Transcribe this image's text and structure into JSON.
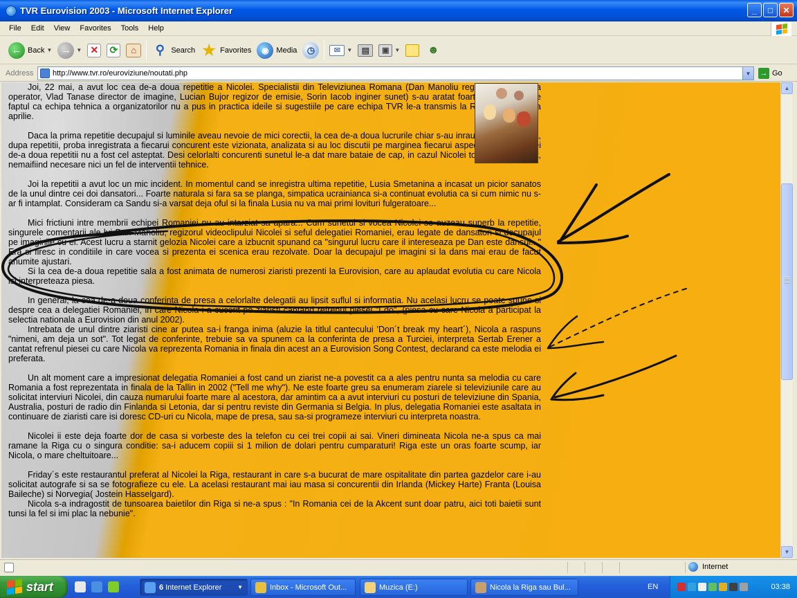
{
  "window": {
    "title": "TVR Eurovision 2003 - Microsoft Internet Explorer"
  },
  "menu": [
    "File",
    "Edit",
    "View",
    "Favorites",
    "Tools",
    "Help"
  ],
  "toolbar": {
    "back": "Back",
    "search": "Search",
    "favorites": "Favorites",
    "media": "Media"
  },
  "address": {
    "label": "Address",
    "url": "http://www.tvr.ro/euroviziune/noutati.php",
    "go": "Go"
  },
  "article": {
    "paragraphs": [
      "Joi, 22 mai, a avut loc cea de-a doua repetitie a Nicolei. Specialistii din Televiziunea Romana (Dan Manoliu regizor, Cristian Ilea operator, Vlad Tanase director de imagine, Lucian Bujor regizor de emisie, Sorin Iacob inginer sunet) s-au aratat foarte nemultumiti de faptul ca echipa tehnica a organizatorilor nu a pus in practica ideile si sugestiile pe care echipa TVR le-a transmis la Riga inca din luna aprilie.",
      "Daca la prima repetitie decupajul si luminile aveau nevoie de mici corectii, la cea de-a doua lucrurile chiar s-au inrautatit. Cu toate ca, dupa repetitii, proba inregistrata a fiecarui concurent este vizionata, analizata si au loc discutii pe marginea fiecarui aspect, rezultatul celei de-a doua repetitii nu a fost cel asteptat. Desi celorlalti concurenti sunetul le-a dat mare bataie de cap, in cazul Nicolei totul a fost perfect, nemaifiind necesare nici un fel de interventii tehnice.",
      "Joi la repetitii a avut loc un mic incident. In momentul cand se inregistra ultima repetitie, Lusia Smetanina a incasat un picior sanatos de la unul dintre cei doi dansatori... Foarte naturala si fara sa se planga, simpatica ucrainianca si-a continuat evolutia ca si cum nimic nu s-ar fi intamplat. Consideram ca Sandu si-a varsat deja oful si la finala Lusia nu va mai primi lovituri fulgeratoare...",
      "Mici frictiuni intre membrii echipei Romaniei nu au intarziat sa apara... Cum sunetul si vocea Nicolei se auzeau superb la repetitie, singurele comentarii ale lui Dan Manoliu, regizorul videoclipului Nicolei si seful delegatiei Romaniei, erau legate de dansatori si decupajul pe imaginile cu ei. Acest lucru a starnit gelozia Nicolei care a izbucnit spunand ca \"singurul lucru care il intereseaza pe Dan este dansul...\" Era si firesc in conditiile in care vocea si prezenta ei scenica erau rezolvate. Doar la decupajul pe imagini si la dans mai erau de facut anumite ajustari.",
      "Si la cea de-a doua repetitie sala a fost animata de numerosi ziaristi prezenti la Eurovision, care au aplaudat evolutia cu care Nicola isi interpreteaza piesa.",
      "In general, la cea de-a doua conferinta de presa a celorlalte delegatii au lipsit suflul si informatia. Nu acelasi lucru se poate spune si despre cea a delegatiei Romaniei, in care Nicola i-a cucerit pe ziaristi cantand refrenul piesei \"I do\", (piesa cu care Nicola a participat la selectia nationala a Eurovision din anul 2002).",
      "Intrebata de unul dintre ziaristi cine ar putea sa-i franga inima (aluzie la titlul cantecului 'Don´t break my heart´), Nicola a raspuns \"nimeni, am deja un sot\". Tot legat de conferinte, trebuie sa va spunem ca la conferinta de presa a Turciei, interpreta Sertab Erener a cantat refrenul piesei cu care Nicola va reprezenta Romania in finala din acest an a Eurovision Song Contest, declarand ca este melodia ei preferata.",
      "Un alt moment care a impresionat delegatia Romaniei a fost cand un ziarist ne-a povestit ca a ales pentru nunta sa melodia cu care Romania a fost reprezentata in finala de la Tallin in 2002 (\"Tell me why\"). Ne este foarte greu sa enumeram ziarele si televiziunile care au solicitat interviuri Nicolei, din cauza numarului foarte mare al acestora, dar amintim ca a avut interviuri cu posturi de televiziune din Spania, Australia, posturi de radio din Finlanda si Letonia, dar si pentru reviste din Germania si Belgia. In plus, delegatia Romaniei este asaltata in continuare de ziaristi care isi doresc CD-uri cu Nicola, mape de presa, sau sa-si programeze interviuri cu interpreta noastra.",
      "Nicolei ii este deja foarte dor de casa si vorbeste des la telefon cu cei trei copii ai sai. Vineri dimineata Nicola ne-a spus ca mai ramane la Riga cu o singura conditie: sa-i aducem copiii si 1 milion de dolari pentru cumparaturi! Riga este un oras foarte scump, iar Nicola, o mare cheltuitoare...",
      "Friday´s este restaurantul preferat al Nicolei la Riga, restaurant in care s-a bucurat de mare ospitalitate din partea gazdelor care i-au solicitat autografe si sa se fotografieze cu ele. La acelasi restaurant mai iau masa si concurentii din Irlanda (Mickey Harte) Franta (Louisa Baileche) si Norvegia( Jostein Hasselgard).",
      "Nicola s-a indragostit de tunsoarea baietilor din Riga si ne-a spus : \"In Romania cei de la Akcent sunt doar patru, aici toti baietii sunt tunsi la fel si imi plac la nebunie\"."
    ]
  },
  "statusbar": {
    "zone": "Internet"
  },
  "taskbar": {
    "start": "start",
    "tasks": [
      {
        "count": "6",
        "label": "Internet Explorer"
      },
      {
        "label": "Inbox - Microsoft Out..."
      },
      {
        "label": "Muzica (E:)"
      },
      {
        "label": "Nicola la Riga sau Bul..."
      }
    ],
    "lang": "EN",
    "clock": "03:38"
  },
  "icons": {
    "back": "back-arrow-icon",
    "forward": "forward-arrow-icon",
    "stop": "stop-icon",
    "refresh": "refresh-icon",
    "home": "home-icon",
    "search": "search-icon",
    "favorites": "star-icon",
    "media": "media-icon",
    "history": "history-icon",
    "mail": "mail-icon",
    "print": "print-icon",
    "edit": "edit-icon",
    "discuss": "note-icon",
    "messenger": "messenger-icon"
  }
}
